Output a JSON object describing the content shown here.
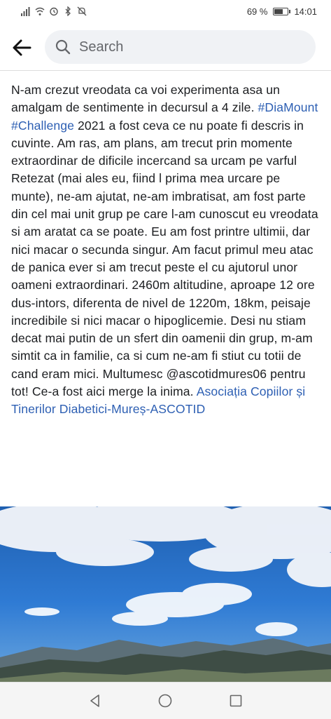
{
  "status_bar": {
    "battery_percent": "69 %",
    "battery_level": 0.69,
    "time": "14:01",
    "icons": [
      "signal-icon",
      "wifi-icon",
      "alarm-icon",
      "bluetooth-icon",
      "mute-icon"
    ]
  },
  "header": {
    "back_icon": "back-arrow-icon",
    "search_placeholder": "Search"
  },
  "post": {
    "text_1": "N-am crezut vreodata ca voi experimenta asa un amalgam de sentimente in decursul a 4 zile. ",
    "hashtag_1": "#DiaMount",
    "space_1": " ",
    "hashtag_2": "#Challenge",
    "text_2": " 2021 a fost ceva ce nu poate fi descris in cuvinte. Am ras, am plans, am trecut prin momente extraordinar de dificile incercand sa urcam pe varful Retezat (mai ales eu, fiind l prima mea urcare pe munte), ne-am ajutat, ne-am imbratisat, am fost parte din cel mai unit grup pe care l-am cunoscut eu vreodata si am aratat ca se poate. Eu am fost printre ultimii, dar nici macar o secunda singur. Am facut primul meu atac de panica ever si am trecut peste el cu ajutorul unor oameni extraordinari. 2460m altitudine, aproape 12 ore dus-intors, diferenta de nivel de 1220m, 18km, peisaje incredibile si nici macar o hipoglicemie. Desi nu stiam decat mai putin de un sfert din oamenii din grup, m-am simtit ca in familie, ca si cum ne-am fi stiut cu totii de cand eram mici. Multumesc @ascotidmures06 pentru tot! Ce-a fost aici merge la inima. ",
    "page_link": "Asociația Copiilor și Tinerilor Diabetici-Mureș-ASCOTID"
  },
  "colors": {
    "link": "#2d5fb3",
    "text": "#1c1e21",
    "search_bg": "#f0f2f5"
  },
  "navbar": {
    "icons": [
      "nav-back-icon",
      "nav-home-icon",
      "nav-recents-icon"
    ]
  }
}
